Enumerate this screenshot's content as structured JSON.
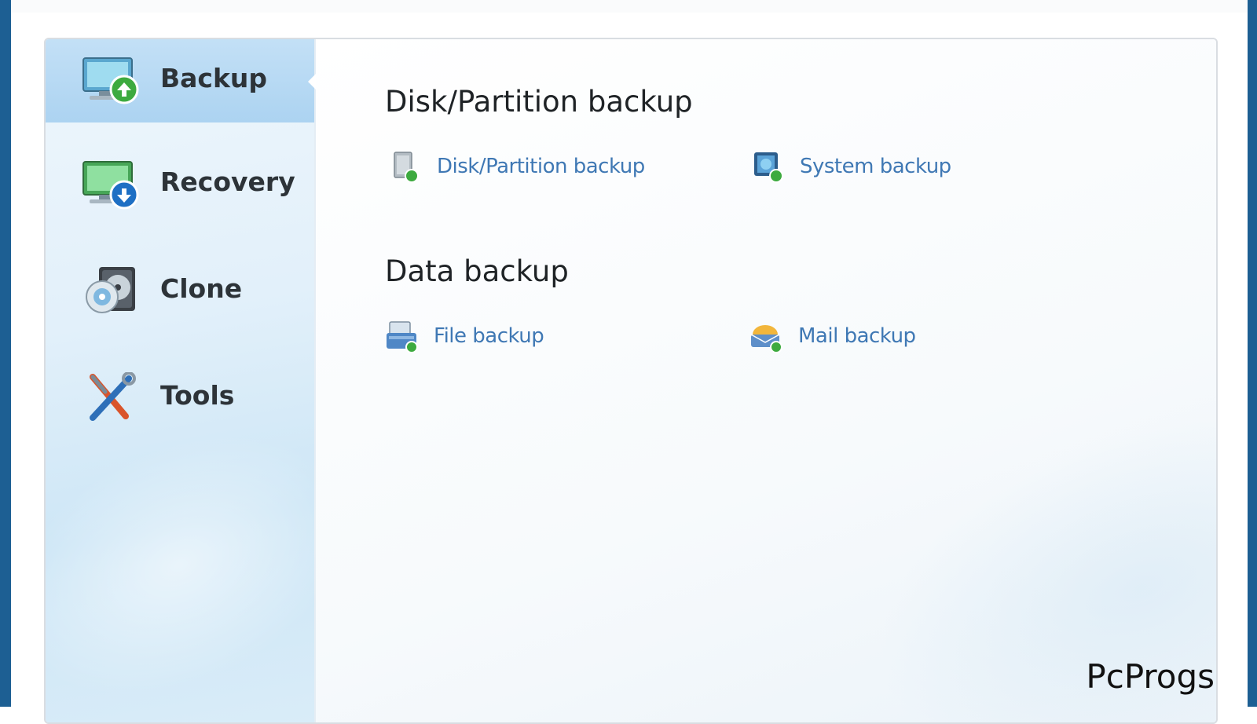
{
  "sidebar": {
    "items": [
      {
        "label": "Backup",
        "icon": "backup-monitor-icon",
        "active": true
      },
      {
        "label": "Recovery",
        "icon": "recovery-monitor-icon",
        "active": false
      },
      {
        "label": "Clone",
        "icon": "clone-disk-icon",
        "active": false
      },
      {
        "label": "Tools",
        "icon": "tools-icon",
        "active": false
      }
    ]
  },
  "main": {
    "sections": [
      {
        "title": "Disk/Partition backup",
        "links": [
          {
            "label": "Disk/Partition backup",
            "icon": "disk-icon"
          },
          {
            "label": "System backup",
            "icon": "system-icon"
          }
        ]
      },
      {
        "title": "Data backup",
        "links": [
          {
            "label": "File backup",
            "icon": "file-icon"
          },
          {
            "label": "Mail backup",
            "icon": "mail-icon"
          }
        ]
      }
    ]
  },
  "watermark": "PcProgs",
  "colors": {
    "accent": "#3f78b4",
    "frame": "#1d5f93",
    "active_nav": "#b5d8f3",
    "green_badge": "#3daa3f",
    "blue_badge": "#1e6fc4"
  }
}
